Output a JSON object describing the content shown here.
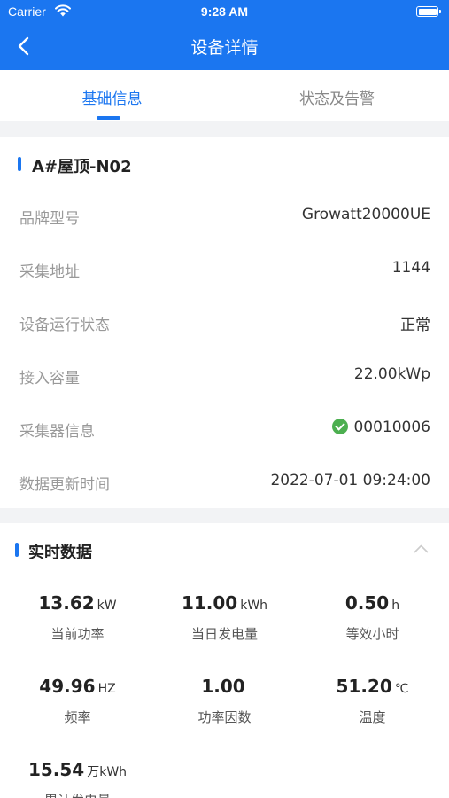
{
  "status_bar": {
    "carrier": "Carrier",
    "time": "9:28 AM"
  },
  "nav": {
    "title": "设备详情"
  },
  "tabs": [
    {
      "label": "基础信息",
      "active": true
    },
    {
      "label": "状态及告警",
      "active": false
    }
  ],
  "device": {
    "name": "A#屋顶-N02",
    "rows": [
      {
        "label": "品牌型号",
        "value": "Growatt20000UE"
      },
      {
        "label": "采集地址",
        "value": "1144"
      },
      {
        "label": "设备运行状态",
        "value": "正常"
      },
      {
        "label": "接入容量",
        "value": "22.00kWp"
      },
      {
        "label": "采集器信息",
        "value": "00010006",
        "status_icon": "check-circle-icon"
      },
      {
        "label": "数据更新时间",
        "value": "2022-07-01 09:24:00"
      }
    ]
  },
  "realtime": {
    "title": "实时数据",
    "metrics": [
      {
        "value": "13.62",
        "unit": "kW",
        "label": "当前功率"
      },
      {
        "value": "11.00",
        "unit": "kWh",
        "label": "当日发电量"
      },
      {
        "value": "0.50",
        "unit": "h",
        "label": "等效小时"
      },
      {
        "value": "49.96",
        "unit": "HZ",
        "label": "频率"
      },
      {
        "value": "1.00",
        "unit": "",
        "label": "功率因数"
      },
      {
        "value": "51.20",
        "unit": "℃",
        "label": "温度"
      },
      {
        "value": "15.54",
        "unit": "万kWh",
        "label": "累计发电量"
      }
    ]
  },
  "colors": {
    "primary": "#1b76f0",
    "success": "#4caf50",
    "background": "#f2f3f5"
  }
}
